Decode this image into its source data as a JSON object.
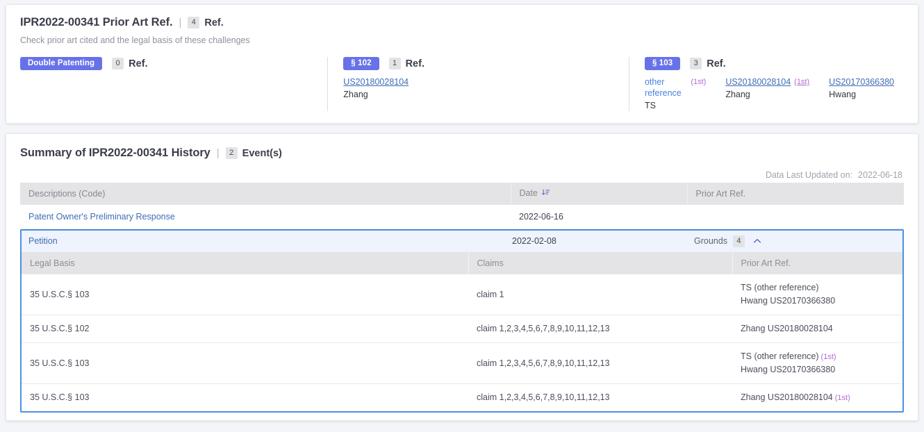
{
  "prior_art_card": {
    "title": "IPR2022-00341 Prior Art Ref.",
    "separator": "|",
    "ref_count": "4",
    "ref_label": "Ref.",
    "subtitle": "Check prior art cited and the legal basis of these challenges",
    "badge_color": "#6872e8",
    "buckets": [
      {
        "badge": "Double Patenting",
        "count": "0",
        "count_label": "Ref.",
        "refs": []
      },
      {
        "badge": "§ 102",
        "count": "1",
        "count_label": "Ref.",
        "refs": [
          {
            "id": "US20180028104",
            "author": "Zhang",
            "tag": "",
            "link_style": "underline"
          }
        ]
      },
      {
        "badge": "§ 103",
        "count": "3",
        "count_label": "Ref.",
        "refs": [
          {
            "id": "other reference",
            "author": "TS",
            "tag": "(1st)",
            "link_style": "plain"
          },
          {
            "id": "US20180028104",
            "author": "Zhang",
            "tag": "(1st)",
            "link_style": "underline"
          },
          {
            "id": "US20170366380",
            "author": "Hwang",
            "tag": "",
            "link_style": "underline"
          }
        ]
      }
    ]
  },
  "history_card": {
    "title": "Summary of IPR2022-00341 History",
    "separator": "|",
    "event_count": "2",
    "event_label": "Event(s)",
    "updated_label": "Data Last Updated on:",
    "updated_value": "2022-06-18",
    "columns": [
      "Descriptions (Code)",
      "Date",
      "Prior Art Ref."
    ],
    "sort_column": "Date",
    "sort_direction": "descending",
    "events": [
      {
        "description": "Patent Owner's Preliminary Response",
        "date": "2022-06-16",
        "prior_art": ""
      }
    ],
    "expanded_event": {
      "description": "Petition",
      "date": "2022-02-08",
      "grounds_label": "Grounds",
      "grounds_count": "4",
      "toggle_icon": "chevron-up",
      "columns": [
        "Legal Basis",
        "Claims",
        "Prior Art Ref."
      ],
      "grounds": [
        {
          "legal_basis": "35 U.S.C.§ 103",
          "claims": "claim 1",
          "prior_art": [
            {
              "text": "TS (other reference)",
              "tag": ""
            },
            {
              "text": "Hwang US20170366380",
              "tag": ""
            }
          ]
        },
        {
          "legal_basis": "35 U.S.C.§ 102",
          "claims": "claim 1,2,3,4,5,6,7,8,9,10,11,12,13",
          "prior_art": [
            {
              "text": "Zhang US20180028104",
              "tag": ""
            }
          ]
        },
        {
          "legal_basis": "35 U.S.C.§ 103",
          "claims": "claim 1,2,3,4,5,6,7,8,9,10,11,12,13",
          "prior_art": [
            {
              "text": "TS (other reference)",
              "tag": "(1st)"
            },
            {
              "text": "Hwang US20170366380",
              "tag": ""
            }
          ]
        },
        {
          "legal_basis": "35 U.S.C.§ 103",
          "claims": "claim 1,2,3,4,5,6,7,8,9,10,11,12,13",
          "prior_art": [
            {
              "text": "Zhang US20180028104",
              "tag": "(1st)"
            }
          ]
        }
      ]
    }
  }
}
